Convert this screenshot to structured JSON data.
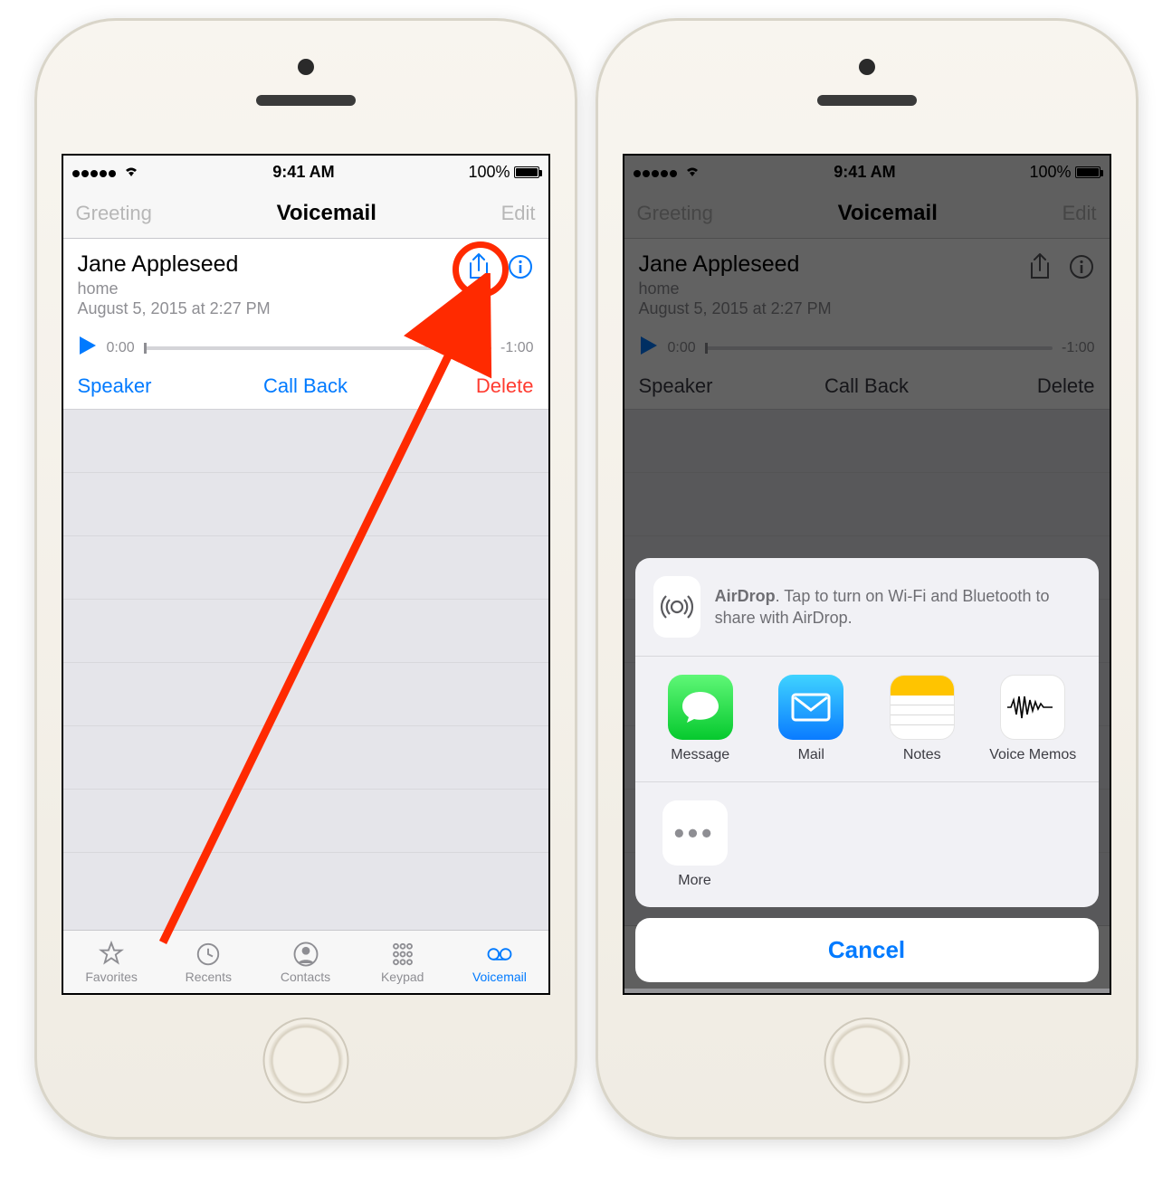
{
  "status": {
    "time": "9:41 AM",
    "battery": "100%"
  },
  "nav": {
    "left": "Greeting",
    "title": "Voicemail",
    "right": "Edit"
  },
  "voicemail": {
    "contact": "Jane Appleseed",
    "label": "home",
    "date": "August 5, 2015 at 2:27 PM",
    "current_time": "0:00",
    "remaining_time": "-1:00",
    "speaker": "Speaker",
    "callback": "Call Back",
    "delete": "Delete"
  },
  "tabs": {
    "favorites": "Favorites",
    "recents": "Recents",
    "contacts": "Contacts",
    "keypad": "Keypad",
    "voicemail": "Voicemail"
  },
  "share": {
    "airdrop_bold": "AirDrop",
    "airdrop_rest": ". Tap to turn on Wi-Fi and Bluetooth to share with AirDrop.",
    "apps": {
      "message": "Message",
      "mail": "Mail",
      "notes": "Notes",
      "voicememos": "Voice Memos"
    },
    "more": "More",
    "cancel": "Cancel"
  }
}
